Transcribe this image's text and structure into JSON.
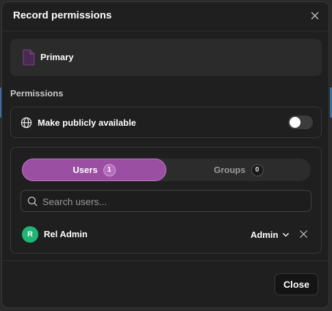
{
  "dialog": {
    "title": "Record permissions",
    "close_icon": "close-icon"
  },
  "record": {
    "name": "Primary",
    "icon": "document-icon",
    "icon_color": "#6b3a75"
  },
  "permissions": {
    "section_label": "Permissions",
    "public_label": "Make publicly available",
    "public_enabled": false
  },
  "tabs": [
    {
      "label": "Users",
      "count": "1",
      "active": true
    },
    {
      "label": "Groups",
      "count": "0",
      "active": false
    }
  ],
  "search": {
    "placeholder": "Search users...",
    "value": ""
  },
  "users": [
    {
      "initial": "R",
      "name": "Rel Admin",
      "role": "Admin"
    }
  ],
  "footer": {
    "close_label": "Close"
  },
  "colors": {
    "accent": "#9b4fa3",
    "avatar": "#1fb574",
    "background": "#1f1f1f"
  }
}
